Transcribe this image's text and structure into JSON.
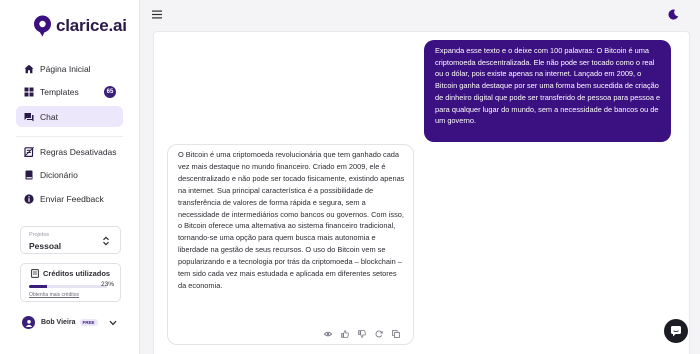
{
  "app": {
    "brand": "clarice.ai",
    "accent": "#3b1080"
  },
  "sidebar": {
    "nav": [
      {
        "label": "Página Inicial",
        "icon": "home-icon"
      },
      {
        "label": "Templates",
        "icon": "grid-icon",
        "badge": "65"
      },
      {
        "label": "Chat",
        "icon": "chat-icon",
        "active": true
      },
      {
        "label": "Regras Desativadas",
        "icon": "rule-off-icon"
      },
      {
        "label": "Dicionário",
        "icon": "book-icon"
      },
      {
        "label": "Enviar Feedback",
        "icon": "info-icon"
      }
    ],
    "project": {
      "label": "Projetos",
      "value": "Pessoal"
    },
    "credits": {
      "title": "Créditos utilizados",
      "percent_label": "23%",
      "percent": 0.23,
      "link": "Obtenha mais créditos"
    },
    "user": {
      "name": "Bob Vieira",
      "plan": "FREE"
    }
  },
  "chat": {
    "user_message": "Expanda esse texto e o deixe com 100 palavras: O Bitcoin é uma criptomoeda descentralizada. Ele não pode ser tocado como o real ou o dólar, pois existe apenas na internet. Lançado em 2009, o Bitcoin ganha destaque por ser uma forma bem sucedida de criação de dinheiro digital que pode ser transferido de pessoa para pessoa e para qualquer lugar do mundo, sem a necessidade de bancos ou de um governo.",
    "ai_message": "O Bitcoin é uma criptomoeda revolucionária que tem ganhado cada vez mais destaque no mundo financeiro. Criado em 2009, ele é descentralizado e não pode ser tocado fisicamente, existindo apenas na internet. Sua principal característica é a possibilidade de transferência de valores de forma rápida e segura, sem a necessidade de intermediários como bancos ou governos. Com isso, o Bitcoin oferece uma alternativa ao sistema financeiro tradicional, tornando-se uma opção para quem busca mais autonomia e liberdade na gestão de seus recursos. O uso do Bitcoin vem se popularizando e a tecnologia por trás da criptomoeda – blockchain – tem sido cada vez mais estudada e aplicada em diferentes setores da economia.",
    "actions": [
      "eye-icon",
      "thumbs-up-icon",
      "thumbs-down-icon",
      "refresh-icon",
      "copy-icon"
    ]
  }
}
